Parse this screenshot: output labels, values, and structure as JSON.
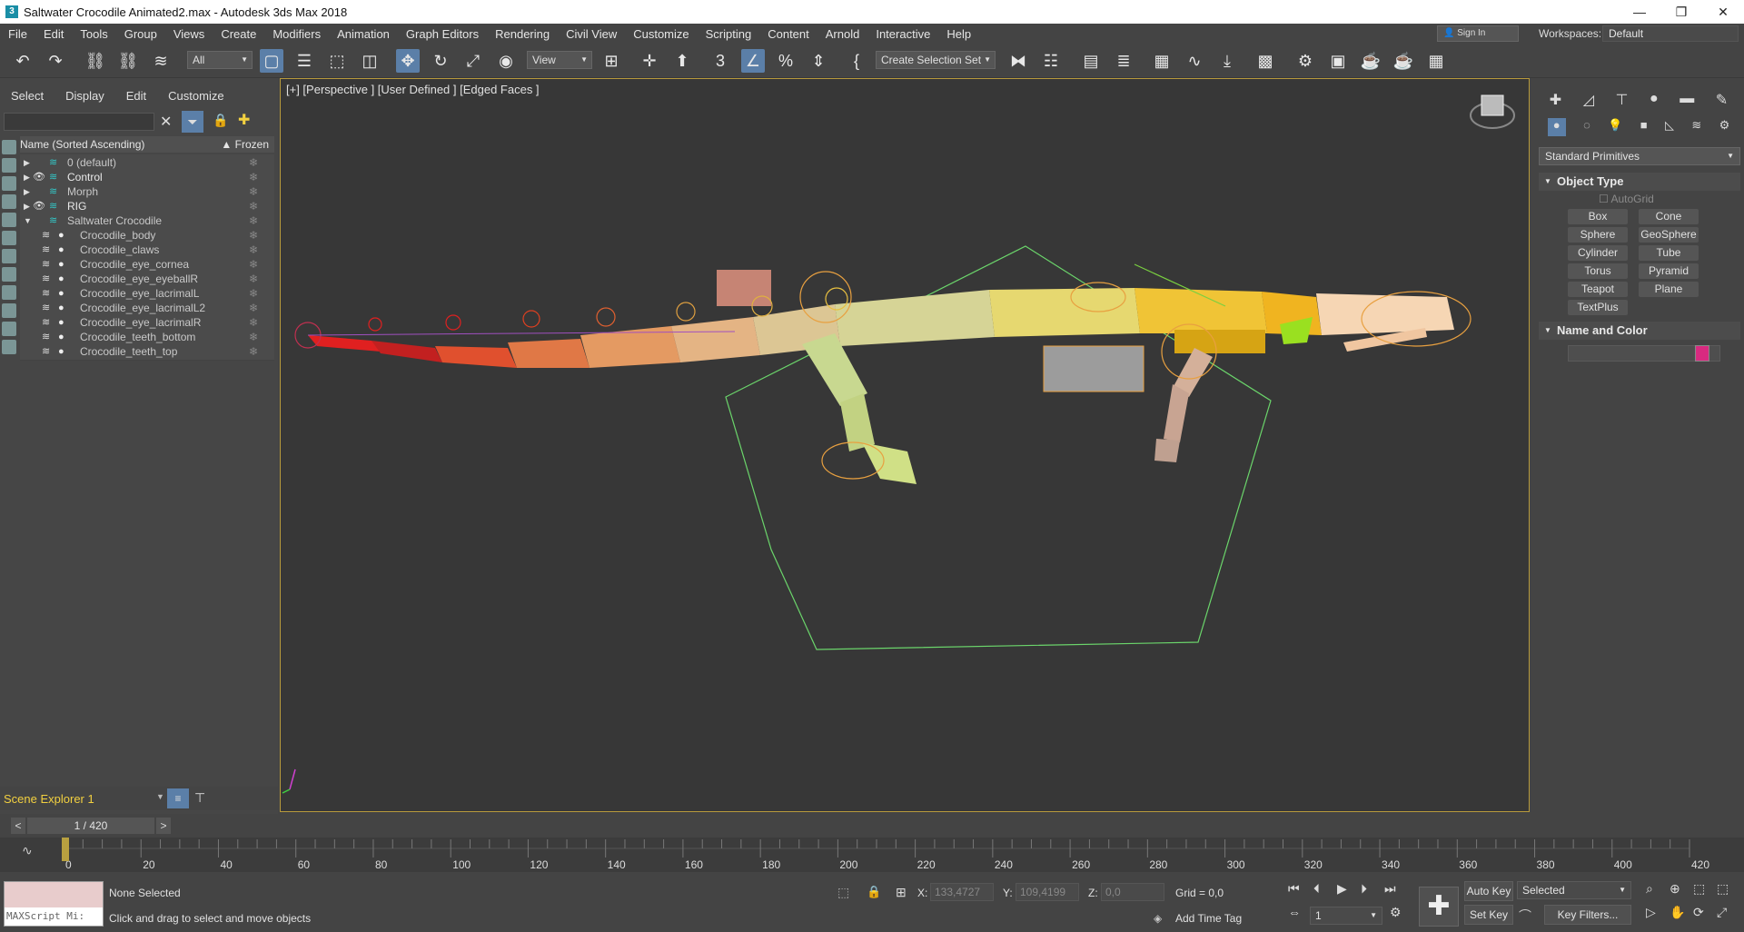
{
  "window": {
    "title": "Saltwater Crocodile Animated2.max - Autodesk 3ds Max 2018",
    "app_icon": "3",
    "minimize": "—",
    "restore": "❐",
    "close": "✕"
  },
  "menu": [
    "File",
    "Edit",
    "Tools",
    "Group",
    "Views",
    "Create",
    "Modifiers",
    "Animation",
    "Graph Editors",
    "Rendering",
    "Civil View",
    "Customize",
    "Scripting",
    "Content",
    "Arnold",
    "Interactive",
    "Help"
  ],
  "sign_in": "Sign In",
  "workspaces": {
    "label": "Workspaces:",
    "value": "Default"
  },
  "toolbar": {
    "filter_value": "All",
    "view_value": "View",
    "selection_set": "Create Selection Set"
  },
  "explorer": {
    "menu": [
      "Select",
      "Display",
      "Edit",
      "Customize"
    ],
    "col_name": "Name (Sorted Ascending)",
    "col_frozen": "Frozen",
    "rows": [
      {
        "name": "0 (default)",
        "level": 0,
        "expand": "▶"
      },
      {
        "name": "Control",
        "level": 0,
        "expand": "▶"
      },
      {
        "name": "Morph",
        "level": 0,
        "expand": "▶"
      },
      {
        "name": "RIG",
        "level": 0,
        "expand": "▶"
      },
      {
        "name": "Saltwater Crocodile",
        "level": 0,
        "expand": "▼"
      },
      {
        "name": "Crocodile_body",
        "level": 1
      },
      {
        "name": "Crocodile_claws",
        "level": 1
      },
      {
        "name": "Crocodile_eye_cornea",
        "level": 1
      },
      {
        "name": "Crocodile_eye_eyeballR",
        "level": 1
      },
      {
        "name": "Crocodile_eye_lacrimalL",
        "level": 1
      },
      {
        "name": "Crocodile_eye_lacrimalL2",
        "level": 1
      },
      {
        "name": "Crocodile_eye_lacrimalR",
        "level": 1
      },
      {
        "name": "Crocodile_teeth_bottom",
        "level": 1
      },
      {
        "name": "Crocodile_teeth_top",
        "level": 1
      }
    ],
    "footer_label": "Scene Explorer 1"
  },
  "viewport": {
    "label": "[+] [Perspective ] [User Defined ] [Edged Faces ]"
  },
  "command_panel": {
    "category": "Standard Primitives",
    "object_type": "Object Type",
    "autogrid": "AutoGrid",
    "buttons": [
      "Box",
      "Cone",
      "Sphere",
      "GeoSphere",
      "Cylinder",
      "Tube",
      "Torus",
      "Pyramid",
      "Teapot",
      "Plane",
      "TextPlus"
    ],
    "name_and_color": "Name and Color",
    "swatch_color": "#d82a80"
  },
  "time_slider": {
    "value": "1 / 420",
    "prev": "<",
    "next": ">"
  },
  "track": {
    "ticks": [
      "0",
      "20",
      "40",
      "60",
      "80",
      "100",
      "120",
      "140",
      "160",
      "180",
      "200",
      "220",
      "240",
      "260",
      "280",
      "300",
      "320",
      "340",
      "360",
      "380",
      "400",
      "420"
    ]
  },
  "status": {
    "maxscript": "MAXScript Mi:",
    "selection": "None Selected",
    "hint": "Click and drag to select and move objects",
    "x_label": "X:",
    "x_value": "133,4727",
    "y_label": "Y:",
    "y_value": "109,4199",
    "z_label": "Z:",
    "z_value": "0,0",
    "grid": "Grid = 0,0",
    "add_time_tag": "Add Time Tag",
    "auto_key": "Auto Key",
    "set_key": "Set Key",
    "selected": "Selected",
    "key_filters": "Key Filters...",
    "frame": "1"
  }
}
